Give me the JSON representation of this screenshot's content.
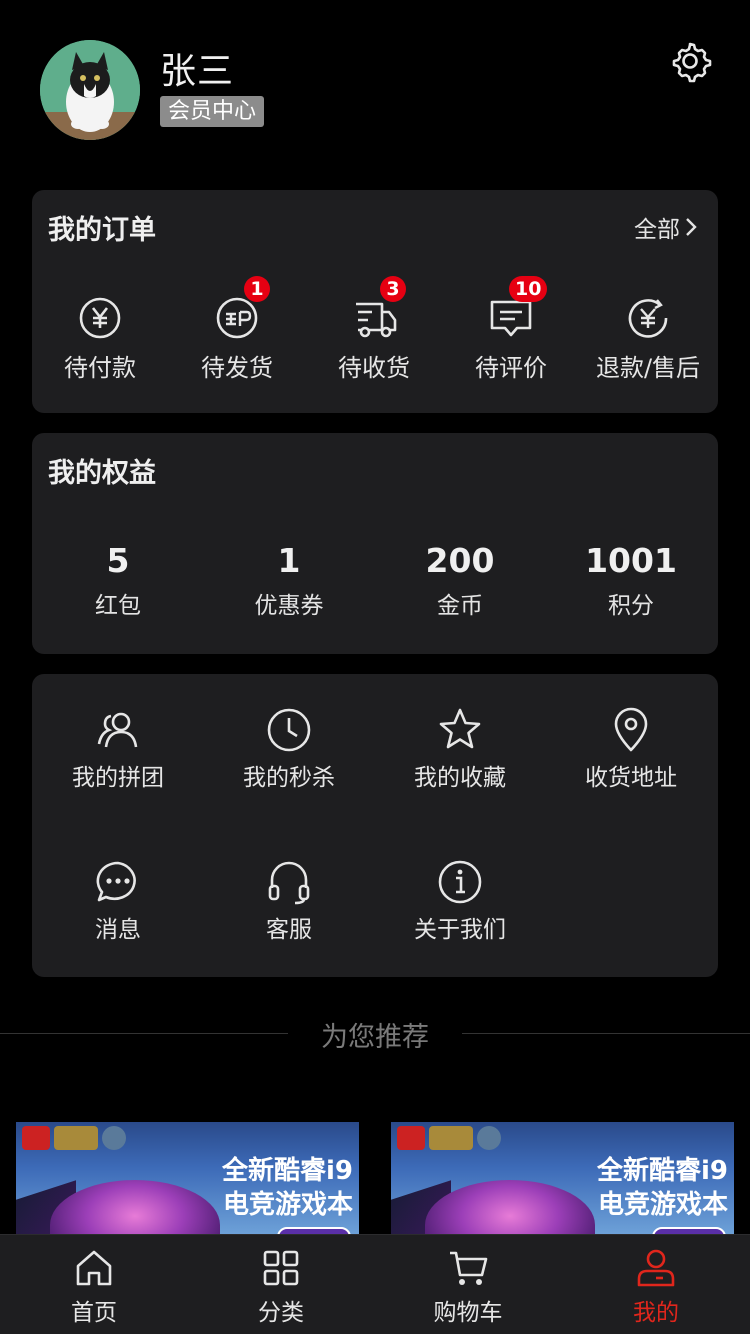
{
  "profile": {
    "name": "张三",
    "member_center": "会员中心"
  },
  "orders": {
    "title": "我的订单",
    "more": "全部",
    "items": [
      {
        "label": "待付款",
        "icon": "yen-circle-icon",
        "badge": null
      },
      {
        "label": "待发货",
        "icon": "mail-post-icon",
        "badge": "1"
      },
      {
        "label": "待收货",
        "icon": "delivery-truck-icon",
        "badge": "3"
      },
      {
        "label": "待评价",
        "icon": "comment-icon",
        "badge": "10"
      },
      {
        "label": "退款/售后",
        "icon": "refund-icon",
        "badge": null
      }
    ]
  },
  "benefits": {
    "title": "我的权益",
    "items": [
      {
        "value": "5",
        "label": "红包"
      },
      {
        "value": "1",
        "label": "优惠券"
      },
      {
        "value": "200",
        "label": "金币"
      },
      {
        "value": "1001",
        "label": "积分"
      }
    ]
  },
  "tools": [
    {
      "label": "我的拼团",
      "icon": "group-users-icon"
    },
    {
      "label": "我的秒杀",
      "icon": "clock-icon"
    },
    {
      "label": "我的收藏",
      "icon": "star-icon"
    },
    {
      "label": "收货地址",
      "icon": "location-pin-icon"
    },
    {
      "label": "消息",
      "icon": "chat-bubble-icon"
    },
    {
      "label": "客服",
      "icon": "headset-icon"
    },
    {
      "label": "关于我们",
      "icon": "info-icon"
    }
  ],
  "recommend": {
    "title": "为您推荐",
    "products": [
      {
        "headline_1": "全新酷睿i9",
        "headline_2": "电竞游戏本"
      },
      {
        "headline_1": "全新酷睿i9",
        "headline_2": "电竞游戏本"
      }
    ]
  },
  "tabbar": {
    "items": [
      {
        "label": "首页",
        "icon": "home-icon"
      },
      {
        "label": "分类",
        "icon": "category-grid-icon"
      },
      {
        "label": "购物车",
        "icon": "cart-icon"
      },
      {
        "label": "我的",
        "icon": "user-icon",
        "active": true
      }
    ]
  },
  "colors": {
    "background": "#000000",
    "card": "#1e1e20",
    "badge": "#e60012",
    "active_tab": "#e0261c",
    "member_badge": "#8c8c8c"
  }
}
